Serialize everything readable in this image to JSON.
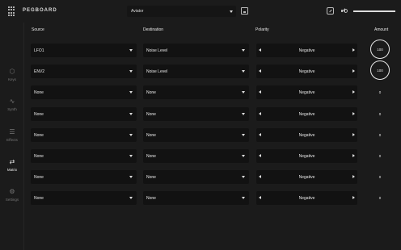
{
  "header": {
    "brand": "PEGBOARD",
    "preset": "Aviator",
    "icons": {
      "logo": "dot-grid-logo",
      "save": "save-icon",
      "share": "share-icon",
      "volume": "volume-icon"
    }
  },
  "sidebar": {
    "items": [
      {
        "label": "Keys",
        "icon": "hexagon-icon"
      },
      {
        "label": "Synth",
        "icon": "waveform-icon"
      },
      {
        "label": "Effects",
        "icon": "sliders-icon"
      },
      {
        "label": "Matrix",
        "icon": "routing-icon",
        "active": true
      },
      {
        "label": "Settings",
        "icon": "gear-icon"
      }
    ]
  },
  "table": {
    "headers": {
      "source": "Source",
      "destination": "Destination",
      "polarity": "Polarity",
      "amount": "Amount"
    },
    "rows": [
      {
        "source": "LFO1",
        "destination": "Noise Level",
        "polarity": "Negative",
        "amount": "100"
      },
      {
        "source": "ENV2",
        "destination": "Noise Level",
        "polarity": "Negative",
        "amount": "100"
      },
      {
        "source": "None",
        "destination": "None",
        "polarity": "Negative",
        "amount": "0"
      },
      {
        "source": "None",
        "destination": "None",
        "polarity": "Negative",
        "amount": "0"
      },
      {
        "source": "None",
        "destination": "None",
        "polarity": "Negative",
        "amount": "0"
      },
      {
        "source": "None",
        "destination": "None",
        "polarity": "Negative",
        "amount": "0"
      },
      {
        "source": "None",
        "destination": "None",
        "polarity": "Negative",
        "amount": "0"
      },
      {
        "source": "None",
        "destination": "None",
        "polarity": "Negative",
        "amount": "0"
      }
    ]
  },
  "colors": {
    "background": "#1b1b1b",
    "field": "#121212",
    "text": "#e8e8e8",
    "muted": "#777777"
  }
}
